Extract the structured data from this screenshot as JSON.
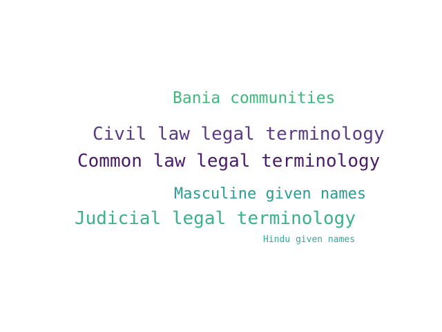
{
  "word_cloud": {
    "words": [
      {
        "text": "Bania communities",
        "color": "#3dba7b"
      },
      {
        "text": "Civil law legal terminology",
        "color": "#5a3a86"
      },
      {
        "text": "Common law legal terminology",
        "color": "#4a1a6b"
      },
      {
        "text": "Masculine given names",
        "color": "#2a9b94"
      },
      {
        "text": "Judicial legal terminology",
        "color": "#3cb08a"
      },
      {
        "text": "Hindu given names",
        "color": "#36a59a"
      }
    ]
  }
}
